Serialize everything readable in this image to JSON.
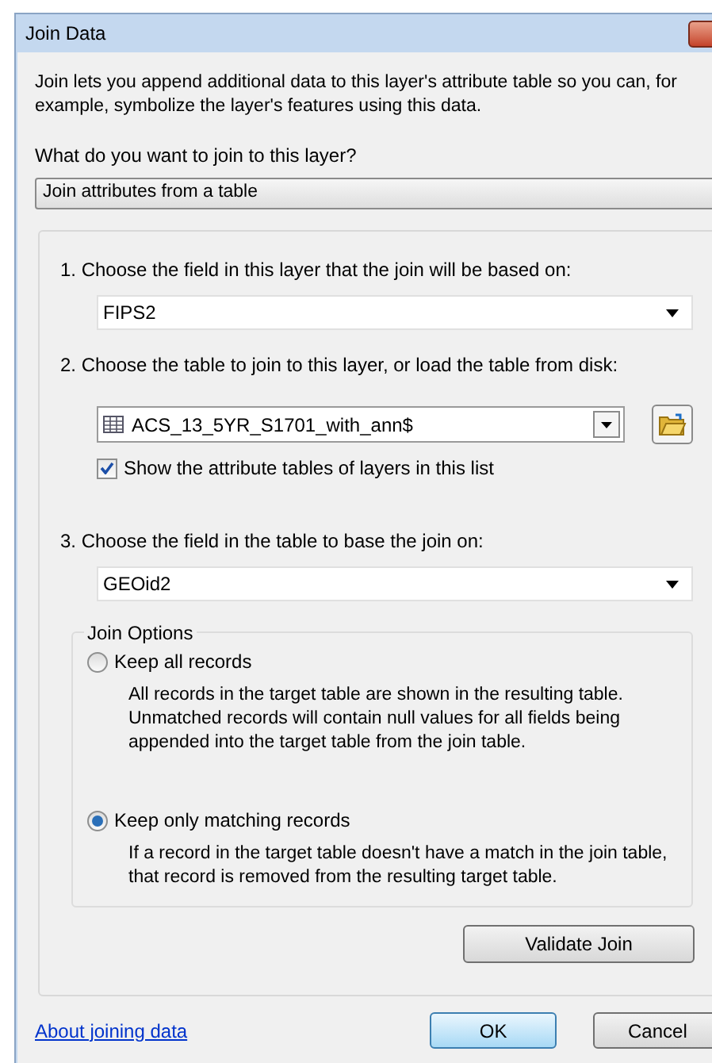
{
  "window": {
    "title": "Join Data"
  },
  "intro": "Join lets you append additional data to this layer's attribute table so you can, for example, symbolize the layer's features using this data.",
  "join_type": {
    "label": "What do you want to join to this layer?",
    "value": "Join attributes from a table"
  },
  "steps": [
    {
      "kind": "field",
      "label": "1.  Choose the field in this layer that the join will be based on:",
      "value": "FIPS2"
    },
    {
      "kind": "table",
      "label": "2.  Choose the table to join to this layer, or load the table from disk:",
      "value": "ACS_13_5YR_S1701_with_ann$",
      "checkbox": {
        "label": "Show the attribute tables of layers in this list",
        "checked": true
      }
    },
    {
      "kind": "field",
      "label": "3.  Choose the field in the table to base the join on:",
      "value": "GEOid2"
    }
  ],
  "join_options": {
    "title": "Join Options",
    "options": [
      {
        "label": "Keep all records",
        "description": "All records in the target table are shown in the resulting table. Unmatched records will contain null values for all fields being appended into the target table from the join table.",
        "selected": false
      },
      {
        "label": "Keep only matching records",
        "description": "If a record in the target table doesn't have a match in the join table, that record is removed from the resulting target table.",
        "selected": true
      }
    ]
  },
  "validate_button": "Validate Join",
  "help_link": "About joining data",
  "buttons": [
    {
      "label": "OK",
      "default": true
    },
    {
      "label": "Cancel",
      "default": false
    }
  ]
}
